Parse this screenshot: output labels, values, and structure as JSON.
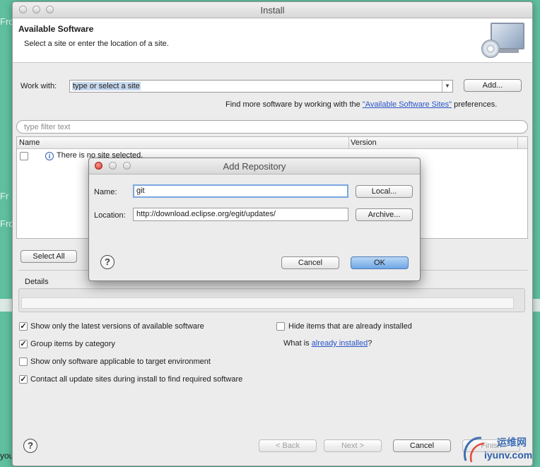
{
  "background": {
    "fragments": [
      "Fro",
      "Fr",
      "Fro",
      "you"
    ]
  },
  "window": {
    "title": "Install",
    "header": {
      "title": "Available Software",
      "subtitle": "Select a site or enter the location of a site."
    },
    "work_with": {
      "label": "Work with:",
      "value": "type or select a site",
      "add_button": "Add..."
    },
    "find_more": {
      "prefix": "Find more software by working with the ",
      "link": "\"Available Software Sites\"",
      "suffix": " preferences."
    },
    "filter": {
      "placeholder": "type filter text"
    },
    "table": {
      "columns": [
        "Name",
        "Version"
      ],
      "rows": [
        {
          "name": "There is no site selected.",
          "checked": false
        }
      ]
    },
    "select_all": "Select All",
    "details": {
      "label": "Details"
    },
    "options": {
      "show_latest": {
        "label": "Show only the latest versions of available software",
        "checked": true
      },
      "group_by_category": {
        "label": "Group items by category",
        "checked": true
      },
      "show_applicable": {
        "label": "Show only software applicable to target environment",
        "checked": false
      },
      "contact_sites": {
        "label": "Contact all update sites during install to find required software",
        "checked": true
      },
      "hide_installed": {
        "label": "Hide items that are already installed",
        "checked": false
      }
    },
    "what_is": {
      "prefix": "What is ",
      "link": "already installed",
      "suffix": "?"
    },
    "footer": {
      "back": "< Back",
      "next": "Next >",
      "cancel": "Cancel",
      "finish": "Finish"
    }
  },
  "dialog": {
    "title": "Add Repository",
    "name_label": "Name:",
    "name_value": "git",
    "location_label": "Location:",
    "location_value": "http://download.eclipse.org/egit/updates/",
    "local_button": "Local...",
    "archive_button": "Archive...",
    "cancel_button": "Cancel",
    "ok_button": "OK"
  },
  "watermark": {
    "text": "运维网",
    "url": "iyunv.com"
  }
}
